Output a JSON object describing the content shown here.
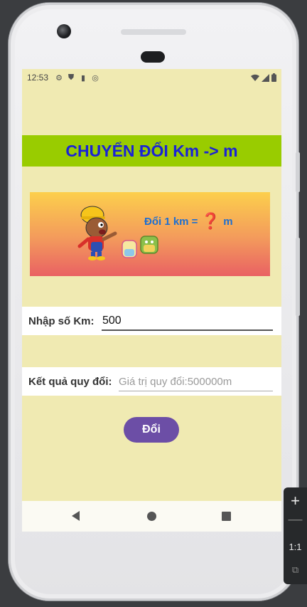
{
  "status_bar": {
    "time": "12:53",
    "left_icons": [
      "settings-icon",
      "shield-icon",
      "sd-card-icon",
      "sync-icon"
    ],
    "right_icons": [
      "wifi-icon",
      "signal-icon",
      "battery-icon"
    ]
  },
  "app": {
    "title": "CHUYỂN ĐỔI Km -> m",
    "banner_text": "Đổi 1 km = ",
    "banner_qmark": "❓",
    "banner_unit": "m",
    "km_label": "Nhập số Km:",
    "km_value": "500",
    "result_label": "Kết quả quy đổi:",
    "result_placeholder": "Giá trị quy đổi:500000m",
    "convert_label": "Đổi"
  },
  "emulator": {
    "zoom_in": "+",
    "zoom_out": "—",
    "actual_size": "1:1",
    "fit": "⧉"
  },
  "colors": {
    "screen_bg": "#f0eab2",
    "title_bar": "#99cc00",
    "title_text": "#1a22d6",
    "button": "#6c4ea6"
  }
}
